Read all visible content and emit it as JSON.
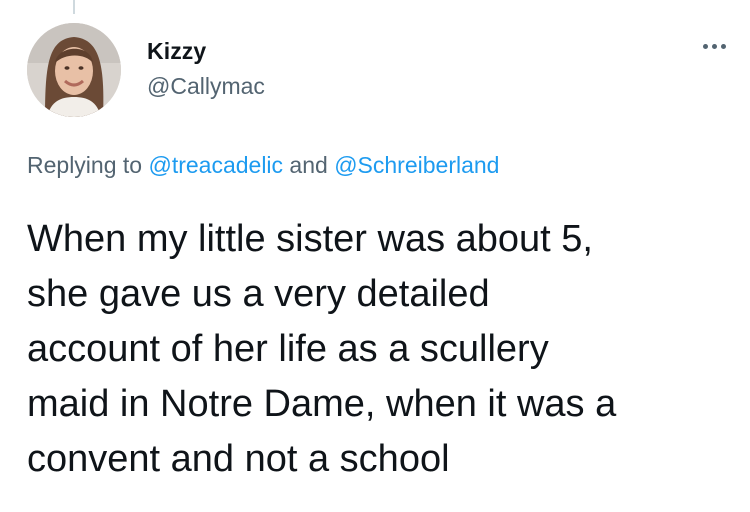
{
  "author": {
    "display_name": "Kizzy",
    "handle": "@Callymac"
  },
  "reply": {
    "prefix": "Replying to ",
    "mention_1": "@treacadelic",
    "conjunction": " and ",
    "mention_2": "@Schreiberland"
  },
  "tweet": {
    "lines": [
      "When my little sister was about 5,",
      "she gave us a very detailed",
      "account of her life as a scullery",
      "maid in Notre Dame, when it was a",
      "convent and not a school"
    ]
  },
  "colors": {
    "text": "#0f1419",
    "secondary": "#536471",
    "link": "#1d9bf0",
    "thread_line": "#cfd9de"
  },
  "icons": {
    "more": "more-horizontal-icon"
  }
}
